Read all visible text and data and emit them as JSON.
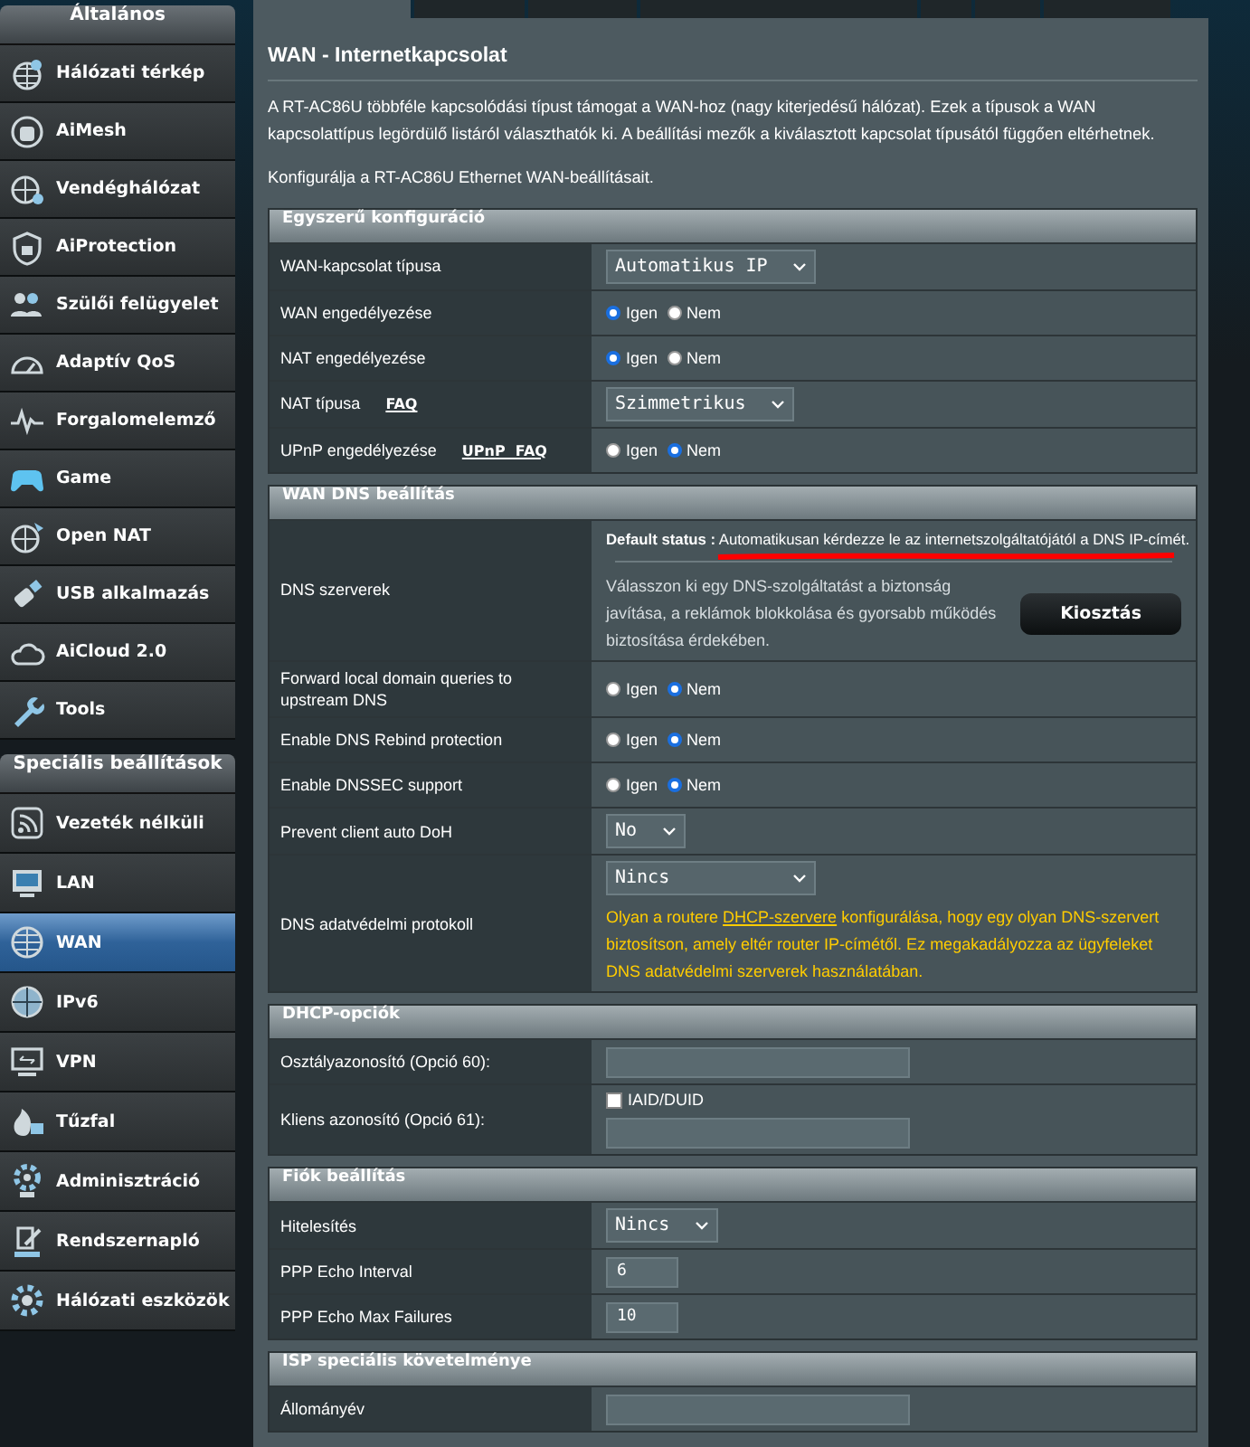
{
  "sidebar": {
    "groups": [
      {
        "title": "Általános",
        "items": [
          {
            "label": "Hálózati térkép",
            "selected": false
          },
          {
            "label": "AiMesh",
            "selected": false
          },
          {
            "label": "Vendéghálózat",
            "selected": false
          },
          {
            "label": "AiProtection",
            "selected": false
          },
          {
            "label": "Szülői felügyelet",
            "selected": false
          },
          {
            "label": "Adaptív QoS",
            "selected": false
          },
          {
            "label": "Forgalomelemző",
            "selected": false
          },
          {
            "label": "Game",
            "selected": false
          },
          {
            "label": "Open NAT",
            "selected": false
          },
          {
            "label": "USB alkalmazás",
            "selected": false
          },
          {
            "label": "AiCloud 2.0",
            "selected": false
          },
          {
            "label": "Tools",
            "selected": false
          }
        ]
      },
      {
        "title": "Speciális beállítások",
        "items": [
          {
            "label": "Vezeték nélküli",
            "selected": false
          },
          {
            "label": "LAN",
            "selected": false
          },
          {
            "label": "WAN",
            "selected": true
          },
          {
            "label": "IPv6",
            "selected": false
          },
          {
            "label": "VPN",
            "selected": false
          },
          {
            "label": "Tűzfal",
            "selected": false
          },
          {
            "label": "Adminisztráció",
            "selected": false
          },
          {
            "label": "Rendszernapló",
            "selected": false
          },
          {
            "label": "Hálózati eszközök",
            "selected": false
          }
        ]
      }
    ]
  },
  "tabs": [
    {
      "selected": true
    },
    {
      "selected": false
    },
    {
      "selected": false
    },
    {
      "selected": false
    },
    {
      "selected": false
    },
    {
      "selected": false
    },
    {
      "selected": false
    }
  ],
  "page": {
    "title": "WAN - Internetkapcsolat",
    "intro": "A RT-AC86U többféle kapcsolódási típust támogat a WAN-hoz (nagy kiterjedésű hálózat). Ezek a típusok a WAN kapcsolattípus legördülő listáról választhatók ki. A beállítási mezők a kiválasztott kapcsolat típusától függően eltérhetnek.",
    "subtitle": "Konfigurálja a RT-AC86U Ethernet WAN-beállításait."
  },
  "sections": [
    {
      "title": "Egyszerű konfiguráció",
      "rows": [
        {
          "kind": "select",
          "label": "WAN-kapcsolat típusa",
          "value": "Automatikus IP"
        },
        {
          "kind": "radio",
          "label": "WAN engedélyezése",
          "options": [
            {
              "label": "Igen",
              "selected": true
            },
            {
              "label": "Nem",
              "selected": false
            }
          ]
        },
        {
          "kind": "radio",
          "label": "NAT engedélyezése",
          "options": [
            {
              "label": "Igen",
              "selected": true
            },
            {
              "label": "Nem",
              "selected": false
            }
          ]
        },
        {
          "kind": "select",
          "label": "NAT típusa",
          "link": "FAQ",
          "value": "Szimmetrikus"
        },
        {
          "kind": "radio",
          "label": "UPnP engedélyezése",
          "link": "UPnP  FAQ",
          "options": [
            {
              "label": "Igen",
              "selected": false
            },
            {
              "label": "Nem",
              "selected": true
            }
          ]
        }
      ]
    },
    {
      "title": "WAN DNS beállítás",
      "rows": [
        {
          "kind": "dns",
          "label": "DNS szerverek",
          "status_label": "Default status :",
          "status_text": "Automatikusan kérdezze le az internetszolgáltatójától a DNS IP-címét.",
          "description": "Válasszon ki egy DNS-szolgáltatást a biztonság javítása, a reklámok blokkolása és gyorsabb működés biztosítása érdekében.",
          "button": "Kiosztás"
        },
        {
          "kind": "radio",
          "label": "Forward local domain queries to upstream DNS",
          "options": [
            {
              "label": "Igen",
              "selected": false
            },
            {
              "label": "Nem",
              "selected": true
            }
          ]
        },
        {
          "kind": "radio",
          "label": "Enable DNS Rebind protection",
          "options": [
            {
              "label": "Igen",
              "selected": false
            },
            {
              "label": "Nem",
              "selected": true
            }
          ]
        },
        {
          "kind": "radio",
          "label": "Enable DNSSEC support",
          "options": [
            {
              "label": "Igen",
              "selected": false
            },
            {
              "label": "Nem",
              "selected": true
            }
          ]
        },
        {
          "kind": "select",
          "label": "Prevent client auto DoH",
          "value": "No"
        },
        {
          "kind": "select_note",
          "label": "DNS adatvédelmi protokoll",
          "value": "Nincs",
          "note_before": "Olyan a routere ",
          "note_link": "DHCP-szervere",
          "note_after": " konfigurálása, hogy egy olyan DNS-szervert biztosítson, amely eltér router IP-címétől. Ez megakadályozza az ügyfeleket DNS adatvédelmi szerverek használatában."
        }
      ]
    },
    {
      "title": "DHCP-opciók",
      "rows": [
        {
          "kind": "input",
          "label": "Osztályazonosító (Opció 60):"
        },
        {
          "kind": "checkbox_input",
          "label": "Kliens azonosító (Opció 61):",
          "checkbox": {
            "label": "IAID/DUID",
            "checked": false
          }
        }
      ]
    },
    {
      "title": "Fiók beállítás",
      "rows": [
        {
          "kind": "select",
          "label": "Hitelesítés",
          "value": "Nincs"
        },
        {
          "kind": "input",
          "label": "PPP Echo Interval",
          "value": "6"
        },
        {
          "kind": "input",
          "label": "PPP Echo Max Failures",
          "value": "10"
        }
      ]
    },
    {
      "title": "ISP speciális követelménye",
      "rows": [
        {
          "kind": "input",
          "label": "Állományév"
        }
      ]
    }
  ]
}
